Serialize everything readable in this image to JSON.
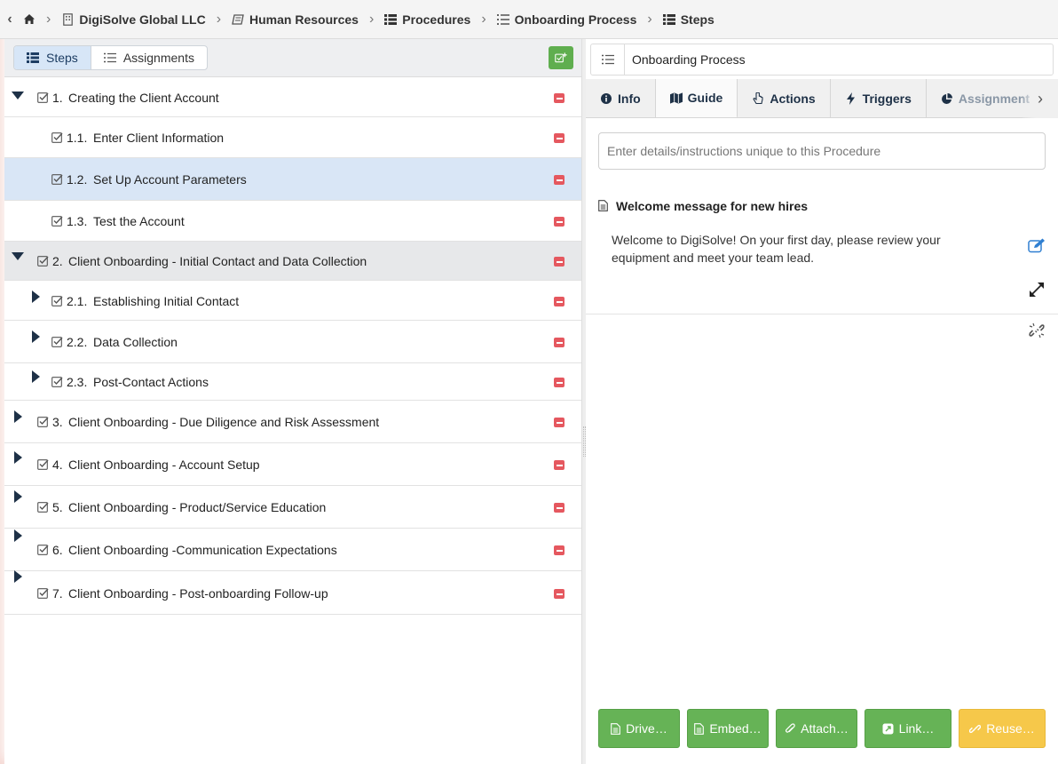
{
  "breadcrumb": {
    "items": [
      {
        "label": ""
      },
      {
        "label": "DigiSolve Global LLC"
      },
      {
        "label": "Human Resources"
      },
      {
        "label": "Procedures"
      },
      {
        "label": "Onboarding Process"
      },
      {
        "label": "Steps"
      }
    ]
  },
  "left_panel": {
    "tabs": [
      {
        "label": "Steps",
        "active": true
      },
      {
        "label": "Assignments",
        "active": false
      }
    ],
    "steps": [
      {
        "number": "1.",
        "title": "Creating the Client Account",
        "level": 0,
        "expanded": true
      },
      {
        "number": "1.1.",
        "title": "Enter Client Information",
        "level": 1
      },
      {
        "number": "1.2.",
        "title": "Set Up Account Parameters",
        "level": 1,
        "selected": true
      },
      {
        "number": "1.3.",
        "title": "Test the Account",
        "level": 1
      },
      {
        "number": "2.",
        "title": "Client Onboarding - Initial Contact and Data Collection",
        "level": 0,
        "expanded": true
      },
      {
        "number": "2.1.",
        "title": "Establishing Initial Contact",
        "level": 1,
        "collapsed": true
      },
      {
        "number": "2.2.",
        "title": "Data Collection",
        "level": 1,
        "collapsed": true
      },
      {
        "number": "2.3.",
        "title": "Post-Contact Actions",
        "level": 1,
        "collapsed": true
      },
      {
        "number": "3.",
        "title": "Client Onboarding - Due Diligence and Risk Assessment",
        "level": 0,
        "collapsed": true
      },
      {
        "number": "4.",
        "title": "Client Onboarding - Account Setup",
        "level": 0,
        "collapsed": true
      },
      {
        "number": "5.",
        "title": "Client Onboarding - Product/Service Education",
        "level": 0,
        "collapsed": true
      },
      {
        "number": "6.",
        "title": "Client Onboarding -Communication Expectations",
        "level": 0,
        "collapsed": true
      },
      {
        "number": "7.",
        "title": "Client Onboarding - Post-onboarding Follow-up",
        "level": 0,
        "collapsed": true
      }
    ]
  },
  "right_panel": {
    "title": "Onboarding Process",
    "tabs": [
      {
        "label": "Info",
        "icon": "info-circle-icon"
      },
      {
        "label": "Guide",
        "icon": "map-icon",
        "active": true
      },
      {
        "label": "Actions",
        "icon": "pointer-icon"
      },
      {
        "label": "Triggers",
        "icon": "bolt-icon"
      },
      {
        "label": "Assignment",
        "icon": "pie-chart-icon"
      }
    ],
    "details_placeholder": "Enter details/instructions unique to this Procedure",
    "guide_item": {
      "title": "Welcome message for new hires",
      "body": "Welcome to DigiSolve! On your first day, please review your equipment and meet your team lead."
    },
    "actions": [
      {
        "label": "Drive…",
        "color": "green"
      },
      {
        "label": "Embed…",
        "color": "green"
      },
      {
        "label": "Attach…",
        "color": "green"
      },
      {
        "label": "Link…",
        "color": "green"
      },
      {
        "label": "Reuse…",
        "color": "yellow"
      }
    ]
  },
  "colors": {
    "accent_green": "#66b356",
    "accent_yellow": "#f6c84a",
    "remove_red": "#e5585f",
    "selected_row": "#d9e6f6",
    "navy": "#1e3147"
  }
}
